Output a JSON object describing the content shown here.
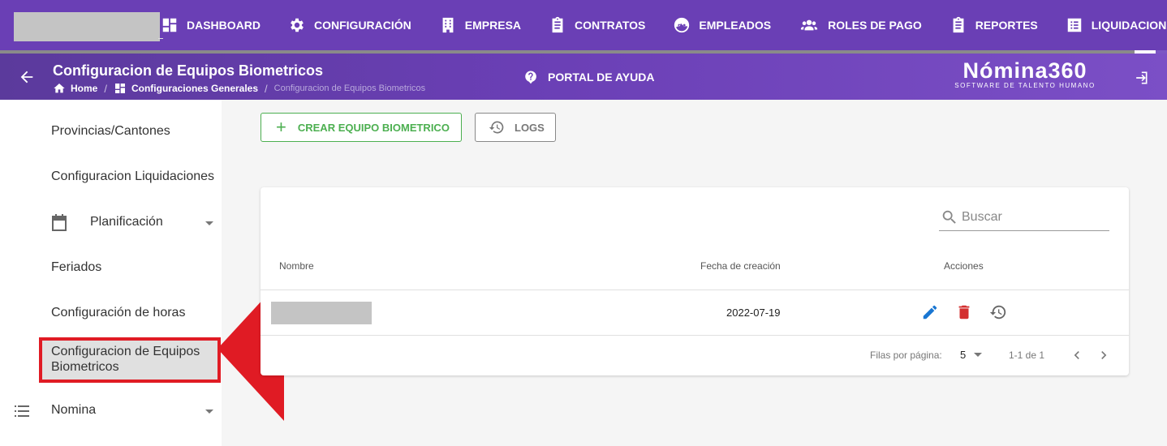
{
  "topnav": {
    "items": [
      {
        "label": "DASHBOARD",
        "icon": "dashboard-icon"
      },
      {
        "label": "CONFIGURACIÓN",
        "icon": "gear-icon"
      },
      {
        "label": "EMPRESA",
        "icon": "building-icon"
      },
      {
        "label": "CONTRATOS",
        "icon": "clipboard-icon"
      },
      {
        "label": "EMPLEADOS",
        "icon": "face-icon"
      },
      {
        "label": "ROLES DE PAGO",
        "icon": "users-icon"
      },
      {
        "label": "REPORTES",
        "icon": "clipboard-icon"
      },
      {
        "label": "LIQUIDACIONES",
        "icon": "list-box-icon"
      },
      {
        "label": "",
        "icon": "calendar-icon"
      }
    ]
  },
  "header": {
    "title": "Configuracion de Equipos Biometricos",
    "breadcrumb": {
      "home": "Home",
      "section": "Configuraciones Generales",
      "current": "Configuracion de Equipos Biometricos",
      "separator": "/"
    },
    "help_label": "PORTAL DE AYUDA",
    "brand_name": "Nómina360",
    "brand_tagline": "SOFTWARE DE TALENTO HUMANO"
  },
  "sidebar": {
    "items": [
      {
        "label": "Provincias/Cantones"
      },
      {
        "label": "Configuracion Liquidaciones"
      },
      {
        "label": "Planificación",
        "icon": "calendar-icon",
        "expandable": true
      },
      {
        "label": "Feriados"
      },
      {
        "label": "Configuración de horas"
      },
      {
        "label": "Configuracion de Equipos Biometricos",
        "selected": true
      },
      {
        "label": "Nomina",
        "icon": "list-icon",
        "expandable": true
      }
    ]
  },
  "toolbar": {
    "create_label": "CREAR EQUIPO BIOMETRICO",
    "create_plus": "+",
    "logs_label": "LOGS"
  },
  "table": {
    "search_placeholder": "Buscar",
    "headers": [
      "Nombre",
      "Fecha de creación",
      "Acciones"
    ],
    "rows": [
      {
        "nombre": "",
        "fecha": "2022-07-19"
      }
    ],
    "footer": {
      "rows_per_page_label": "Filas por página:",
      "rows_per_page_value": "5",
      "range": "1-1 de 1"
    }
  },
  "colors": {
    "primary": "#6a3fb5",
    "success": "#4caf50",
    "edit": "#1976d2",
    "delete": "#d32f2f",
    "annotation": "#e01b24"
  }
}
